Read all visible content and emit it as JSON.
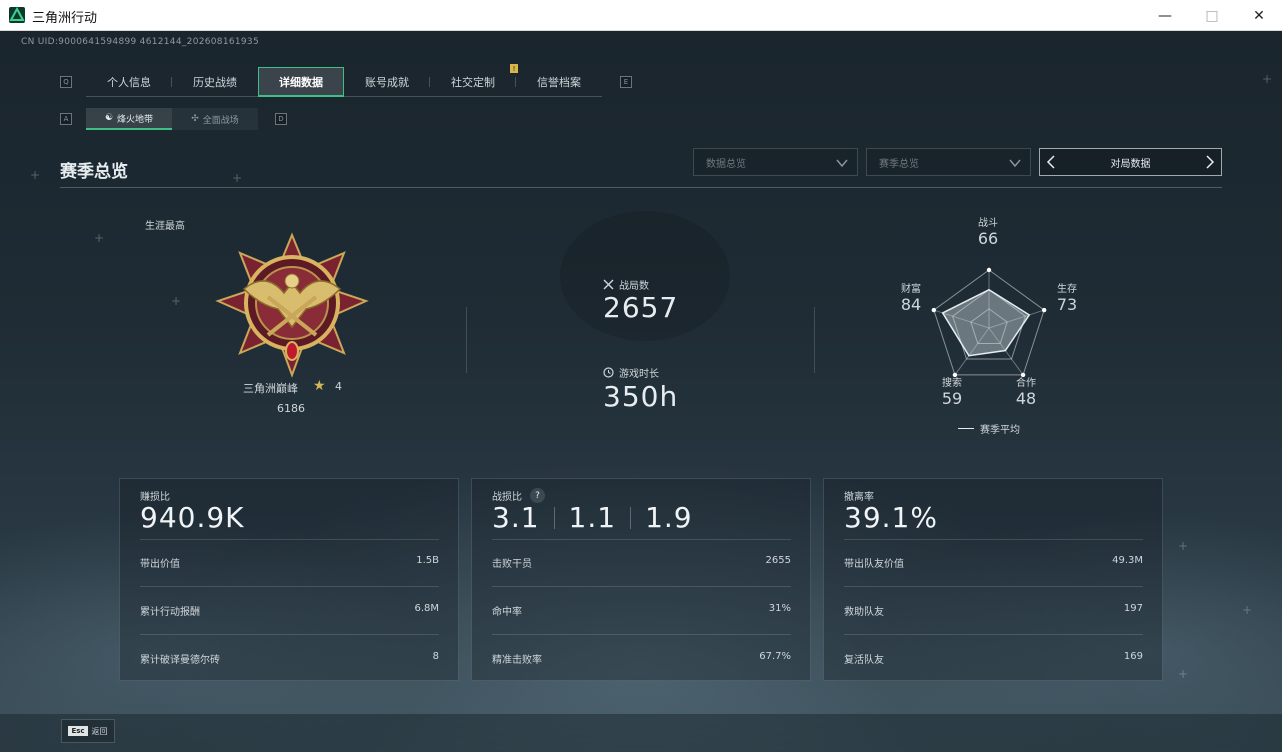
{
  "window": {
    "title": "三角洲行动",
    "min_icon": "minimize-icon",
    "max_icon": "maximize-icon",
    "close_icon": "close-icon"
  },
  "uid": "CN UID:9000641594899 4612144_202608161935",
  "nav": {
    "left_key": "Q",
    "right_key": "E",
    "tabs": [
      "个人信息",
      "历史战绩",
      "详细数据",
      "账号成就",
      "社交定制",
      "信誉档案"
    ],
    "active_tab": "详细数据",
    "badge": "!"
  },
  "subnav": {
    "left_key": "A",
    "right_key": "D",
    "tabs": [
      "烽火地带",
      "全面战场"
    ],
    "active_tab": "烽火地带"
  },
  "section": {
    "title": "赛季总览",
    "dropdown_1": "数据总览",
    "dropdown_2": "赛季总览",
    "cycle_label": "对局数据"
  },
  "career": {
    "label": "生涯最高",
    "rank_name": "三角洲巅峰",
    "rank_stars": "4",
    "rank_score": "6186"
  },
  "center_stats": {
    "matches_label": "战局数",
    "matches_value": "2657",
    "playtime_label": "游戏时长",
    "playtime_value": "350h"
  },
  "radar": {
    "axes": [
      {
        "name": "战斗",
        "value": "66"
      },
      {
        "name": "生存",
        "value": "73"
      },
      {
        "name": "合作",
        "value": "48"
      },
      {
        "name": "搜索",
        "value": "59"
      },
      {
        "name": "财富",
        "value": "84"
      }
    ],
    "legend": "赛季平均"
  },
  "cards": {
    "profit": {
      "label": "赚损比",
      "big": "940.9K",
      "rows": [
        {
          "label": "带出价值",
          "value": "1.5B"
        },
        {
          "label": "累计行动报酬",
          "value": "6.8M"
        },
        {
          "label": "累计破译曼德尔砖",
          "value": "8"
        }
      ]
    },
    "kd": {
      "label": "战损比",
      "help": "?",
      "big_values": [
        "3.1",
        "1.1",
        "1.9"
      ],
      "rows": [
        {
          "label": "击败干员",
          "value": "2655"
        },
        {
          "label": "命中率",
          "value": "31%"
        },
        {
          "label": "精准击败率",
          "value": "67.7%"
        }
      ]
    },
    "extract": {
      "label": "撤离率",
      "big": "39.1%",
      "rows": [
        {
          "label": "带出队友价值",
          "value": "49.3M"
        },
        {
          "label": "救助队友",
          "value": "197"
        },
        {
          "label": "复活队友",
          "value": "169"
        }
      ]
    }
  },
  "footer": {
    "esc_key": "Esc",
    "esc_label": "返回"
  },
  "colors": {
    "accent": "#3fbf86",
    "gold": "#d6b45a",
    "badge": "#d8b64a"
  }
}
